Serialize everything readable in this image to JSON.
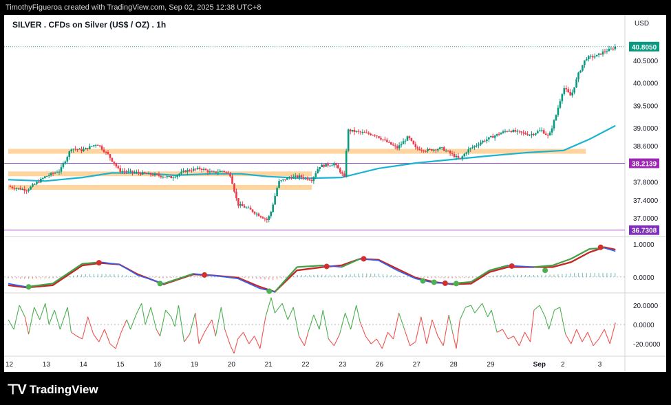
{
  "header": {
    "attribution": "TimothyFigueroa created with TradingView.com, Sep 02, 2025 12:38 UTC+8"
  },
  "brand": {
    "name": "TradingView"
  },
  "chart_data": {
    "type": "candlestick",
    "title": "SILVER . CFDs on Silver (US$ / OZ) . 1h",
    "currency": "USD",
    "price_axis_ticks": [
      40.5,
      40.0,
      39.5,
      39.0,
      38.6,
      37.8,
      37.4,
      37.0
    ],
    "price_range": [
      36.55,
      41.0
    ],
    "price_scale_labels": {
      "last_price": "40.8050",
      "level_upper": "38.2139",
      "level_lower": "36.7308"
    },
    "last_price": 40.805,
    "horizontal_levels": [
      38.2139,
      36.7308
    ],
    "zones": [
      {
        "y": 38.48,
        "from_day": 0,
        "to_day": 15.6
      },
      {
        "y": 37.98,
        "from_day": 0,
        "to_day": 8.2
      },
      {
        "y": 37.68,
        "from_day": 0,
        "to_day": 8.2
      }
    ],
    "time_labels": [
      "12",
      "13",
      "14",
      "15",
      "16",
      "19",
      "20",
      "21",
      "22",
      "23",
      "26",
      "27",
      "28",
      "29",
      "Sep",
      "2",
      "3"
    ],
    "price_path": [
      [
        0,
        37.7
      ],
      [
        0.5,
        37.62
      ],
      [
        0.8,
        37.8
      ],
      [
        1.0,
        37.92
      ],
      [
        1.4,
        38.05
      ],
      [
        1.7,
        38.55
      ],
      [
        2.0,
        38.5
      ],
      [
        2.4,
        38.65
      ],
      [
        2.7,
        38.4
      ],
      [
        3.0,
        38.05
      ],
      [
        3.5,
        38.0
      ],
      [
        4.0,
        37.95
      ],
      [
        4.4,
        37.9
      ],
      [
        4.8,
        38.05
      ],
      [
        5.2,
        38.1
      ],
      [
        5.5,
        38.0
      ],
      [
        5.8,
        38.05
      ],
      [
        6.0,
        37.95
      ],
      [
        6.2,
        37.3
      ],
      [
        6.5,
        37.2
      ],
      [
        6.8,
        37.05
      ],
      [
        7.0,
        36.95
      ],
      [
        7.1,
        37.15
      ],
      [
        7.3,
        37.8
      ],
      [
        7.6,
        37.9
      ],
      [
        7.9,
        37.92
      ],
      [
        8.2,
        37.85
      ],
      [
        8.4,
        38.15
      ],
      [
        8.8,
        38.2
      ],
      [
        9.0,
        38.0
      ],
      [
        9.1,
        37.85
      ],
      [
        9.15,
        38.95
      ],
      [
        9.5,
        38.9
      ],
      [
        9.9,
        38.85
      ],
      [
        10.2,
        38.7
      ],
      [
        10.5,
        38.55
      ],
      [
        10.8,
        38.8
      ],
      [
        11.0,
        38.55
      ],
      [
        11.3,
        38.5
      ],
      [
        11.7,
        38.55
      ],
      [
        12.0,
        38.4
      ],
      [
        12.2,
        38.3
      ],
      [
        12.4,
        38.5
      ],
      [
        12.8,
        38.7
      ],
      [
        13.2,
        38.85
      ],
      [
        13.5,
        38.95
      ],
      [
        13.8,
        38.9
      ],
      [
        14.1,
        38.85
      ],
      [
        14.4,
        38.95
      ],
      [
        14.6,
        38.8
      ],
      [
        14.8,
        39.3
      ],
      [
        15.0,
        39.9
      ],
      [
        15.2,
        39.7
      ],
      [
        15.4,
        40.2
      ],
      [
        15.6,
        40.55
      ],
      [
        15.9,
        40.6
      ],
      [
        16.1,
        40.7
      ],
      [
        16.3,
        40.75
      ],
      [
        16.4,
        40.805
      ]
    ],
    "ma_path": [
      [
        0,
        37.85
      ],
      [
        1.0,
        37.82
      ],
      [
        2.0,
        37.9
      ],
      [
        2.8,
        38.0
      ],
      [
        3.5,
        38.0
      ],
      [
        4.5,
        37.95
      ],
      [
        5.5,
        37.98
      ],
      [
        6.3,
        37.98
      ],
      [
        7.0,
        37.92
      ],
      [
        8.0,
        37.88
      ],
      [
        9.0,
        37.9
      ],
      [
        10.0,
        38.1
      ],
      [
        11.0,
        38.22
      ],
      [
        12.0,
        38.3
      ],
      [
        13.0,
        38.38
      ],
      [
        14.0,
        38.45
      ],
      [
        15.0,
        38.5
      ],
      [
        15.7,
        38.75
      ],
      [
        16.4,
        39.05
      ]
    ],
    "oscillator_1": {
      "ylim": [
        -0.4,
        1.1
      ],
      "tick_labels": [
        "1.0000",
        "0.0000"
      ],
      "fast_line": [
        [
          0,
          -0.2
        ],
        [
          0.5,
          -0.3
        ],
        [
          1.2,
          -0.2
        ],
        [
          2.0,
          0.4
        ],
        [
          2.5,
          0.45
        ],
        [
          3.0,
          0.38
        ],
        [
          3.5,
          0.05
        ],
        [
          4.2,
          -0.2
        ],
        [
          5.0,
          0.1
        ],
        [
          5.5,
          0.05
        ],
        [
          6.2,
          -0.05
        ],
        [
          6.8,
          -0.35
        ],
        [
          7.2,
          -0.45
        ],
        [
          7.8,
          0.3
        ],
        [
          8.5,
          0.35
        ],
        [
          9.0,
          0.3
        ],
        [
          9.5,
          0.55
        ],
        [
          10.0,
          0.5
        ],
        [
          10.5,
          0.2
        ],
        [
          11.0,
          -0.05
        ],
        [
          11.5,
          -0.18
        ],
        [
          12.0,
          -0.2
        ],
        [
          12.5,
          -0.15
        ],
        [
          13.0,
          0.2
        ],
        [
          13.5,
          0.35
        ],
        [
          14.2,
          0.3
        ],
        [
          14.7,
          0.35
        ],
        [
          15.2,
          0.55
        ],
        [
          15.7,
          0.85
        ],
        [
          16.1,
          0.88
        ],
        [
          16.4,
          0.78
        ]
      ],
      "slow_line": [
        [
          0,
          -0.25
        ],
        [
          0.5,
          -0.32
        ],
        [
          1.2,
          -0.25
        ],
        [
          2.0,
          0.35
        ],
        [
          2.5,
          0.42
        ],
        [
          3.0,
          0.38
        ],
        [
          3.5,
          0.08
        ],
        [
          4.2,
          -0.22
        ],
        [
          5.0,
          0.08
        ],
        [
          5.5,
          0.05
        ],
        [
          6.2,
          -0.02
        ],
        [
          6.8,
          -0.3
        ],
        [
          7.2,
          -0.45
        ],
        [
          7.8,
          0.2
        ],
        [
          8.5,
          0.3
        ],
        [
          9.0,
          0.35
        ],
        [
          9.5,
          0.55
        ],
        [
          10.0,
          0.52
        ],
        [
          10.5,
          0.25
        ],
        [
          11.0,
          -0.02
        ],
        [
          11.5,
          -0.15
        ],
        [
          12.0,
          -0.22
        ],
        [
          12.5,
          -0.2
        ],
        [
          13.0,
          0.15
        ],
        [
          13.5,
          0.3
        ],
        [
          14.2,
          0.3
        ],
        [
          14.7,
          0.3
        ],
        [
          15.2,
          0.45
        ],
        [
          15.7,
          0.75
        ],
        [
          16.1,
          0.9
        ],
        [
          16.4,
          0.83
        ]
      ],
      "cross_markers": [
        {
          "x": 0.55,
          "y": -0.3,
          "kind": "bull"
        },
        {
          "x": 2.45,
          "y": 0.43,
          "kind": "bear"
        },
        {
          "x": 4.1,
          "y": -0.2,
          "kind": "bull"
        },
        {
          "x": 5.3,
          "y": 0.06,
          "kind": "bear"
        },
        {
          "x": 7.05,
          "y": -0.43,
          "kind": "bull"
        },
        {
          "x": 8.6,
          "y": 0.32,
          "kind": "bear"
        },
        {
          "x": 9.6,
          "y": 0.55,
          "kind": "bear"
        },
        {
          "x": 11.2,
          "y": -0.12,
          "kind": "bull"
        },
        {
          "x": 11.5,
          "y": -0.16,
          "kind": "bull"
        },
        {
          "x": 11.8,
          "y": -0.19,
          "kind": "bear"
        },
        {
          "x": 12.1,
          "y": -0.2,
          "kind": "bull"
        },
        {
          "x": 13.6,
          "y": 0.33,
          "kind": "bear"
        },
        {
          "x": 14.5,
          "y": 0.2,
          "kind": "bull"
        },
        {
          "x": 16.0,
          "y": 0.9,
          "kind": "bear"
        }
      ]
    },
    "oscillator_2": {
      "ylim": [
        -30,
        30
      ],
      "tick_labels": [
        "20.0000",
        "0.0000",
        "-20.0000"
      ],
      "series": [
        [
          0,
          5
        ],
        [
          0.15,
          -5
        ],
        [
          0.3,
          20
        ],
        [
          0.45,
          8
        ],
        [
          0.55,
          -10
        ],
        [
          0.7,
          18
        ],
        [
          0.85,
          5
        ],
        [
          1.0,
          22
        ],
        [
          1.1,
          0
        ],
        [
          1.25,
          15
        ],
        [
          1.4,
          -5
        ],
        [
          1.6,
          18
        ],
        [
          1.7,
          -8
        ],
        [
          1.85,
          -12
        ],
        [
          2.0,
          -15
        ],
        [
          2.15,
          8
        ],
        [
          2.3,
          -10
        ],
        [
          2.45,
          -18
        ],
        [
          2.6,
          -5
        ],
        [
          2.75,
          -20
        ],
        [
          2.9,
          -25
        ],
        [
          3.05,
          -8
        ],
        [
          3.2,
          5
        ],
        [
          3.3,
          -5
        ],
        [
          3.45,
          10
        ],
        [
          3.6,
          22
        ],
        [
          3.7,
          0
        ],
        [
          3.85,
          18
        ],
        [
          4.0,
          -5
        ],
        [
          4.1,
          -12
        ],
        [
          4.25,
          15
        ],
        [
          4.4,
          8
        ],
        [
          4.5,
          -2
        ],
        [
          4.6,
          20
        ],
        [
          4.75,
          -18
        ],
        [
          4.9,
          -10
        ],
        [
          5.05,
          12
        ],
        [
          5.15,
          -20
        ],
        [
          5.3,
          -8
        ],
        [
          5.5,
          5
        ],
        [
          5.6,
          -12
        ],
        [
          5.75,
          18
        ],
        [
          5.85,
          -5
        ],
        [
          6.0,
          -22
        ],
        [
          6.1,
          -30
        ],
        [
          6.2,
          -15
        ],
        [
          6.35,
          -8
        ],
        [
          6.5,
          -20
        ],
        [
          6.65,
          -12
        ],
        [
          6.8,
          -25
        ],
        [
          6.95,
          8
        ],
        [
          7.1,
          28
        ],
        [
          7.2,
          12
        ],
        [
          7.4,
          22
        ],
        [
          7.55,
          5
        ],
        [
          7.7,
          18
        ],
        [
          7.85,
          -12
        ],
        [
          8.0,
          -22
        ],
        [
          8.1,
          -8
        ],
        [
          8.25,
          10
        ],
        [
          8.4,
          -5
        ],
        [
          8.5,
          15
        ],
        [
          8.65,
          -15
        ],
        [
          8.8,
          -22
        ],
        [
          8.95,
          -10
        ],
        [
          9.1,
          12
        ],
        [
          9.25,
          -5
        ],
        [
          9.4,
          20
        ],
        [
          9.5,
          3
        ],
        [
          9.65,
          -12
        ],
        [
          9.8,
          -20
        ],
        [
          9.95,
          -15
        ],
        [
          10.1,
          -25
        ],
        [
          10.25,
          -8
        ],
        [
          10.4,
          -15
        ],
        [
          10.55,
          12
        ],
        [
          10.7,
          -5
        ],
        [
          10.85,
          -22
        ],
        [
          11.0,
          -18
        ],
        [
          11.15,
          8
        ],
        [
          11.3,
          -20
        ],
        [
          11.45,
          5
        ],
        [
          11.6,
          -12
        ],
        [
          11.75,
          -22
        ],
        [
          11.9,
          10
        ],
        [
          12.0,
          -8
        ],
        [
          12.1,
          -25
        ],
        [
          12.2,
          5
        ],
        [
          12.35,
          18
        ],
        [
          12.5,
          20
        ],
        [
          12.6,
          12
        ],
        [
          12.8,
          22
        ],
        [
          12.95,
          8
        ],
        [
          13.05,
          15
        ],
        [
          13.2,
          -8
        ],
        [
          13.35,
          -5
        ],
        [
          13.5,
          -15
        ],
        [
          13.65,
          -12
        ],
        [
          13.8,
          -22
        ],
        [
          13.95,
          -8
        ],
        [
          14.1,
          -18
        ],
        [
          14.2,
          15
        ],
        [
          14.35,
          20
        ],
        [
          14.5,
          8
        ],
        [
          14.6,
          -5
        ],
        [
          14.75,
          15
        ],
        [
          14.9,
          18
        ],
        [
          15.05,
          -10
        ],
        [
          15.2,
          -20
        ],
        [
          15.35,
          -5
        ],
        [
          15.5,
          -18
        ],
        [
          15.65,
          -8
        ],
        [
          15.8,
          -22
        ],
        [
          15.95,
          -15
        ],
        [
          16.1,
          -5
        ],
        [
          16.25,
          -20
        ],
        [
          16.4,
          2
        ]
      ]
    }
  }
}
